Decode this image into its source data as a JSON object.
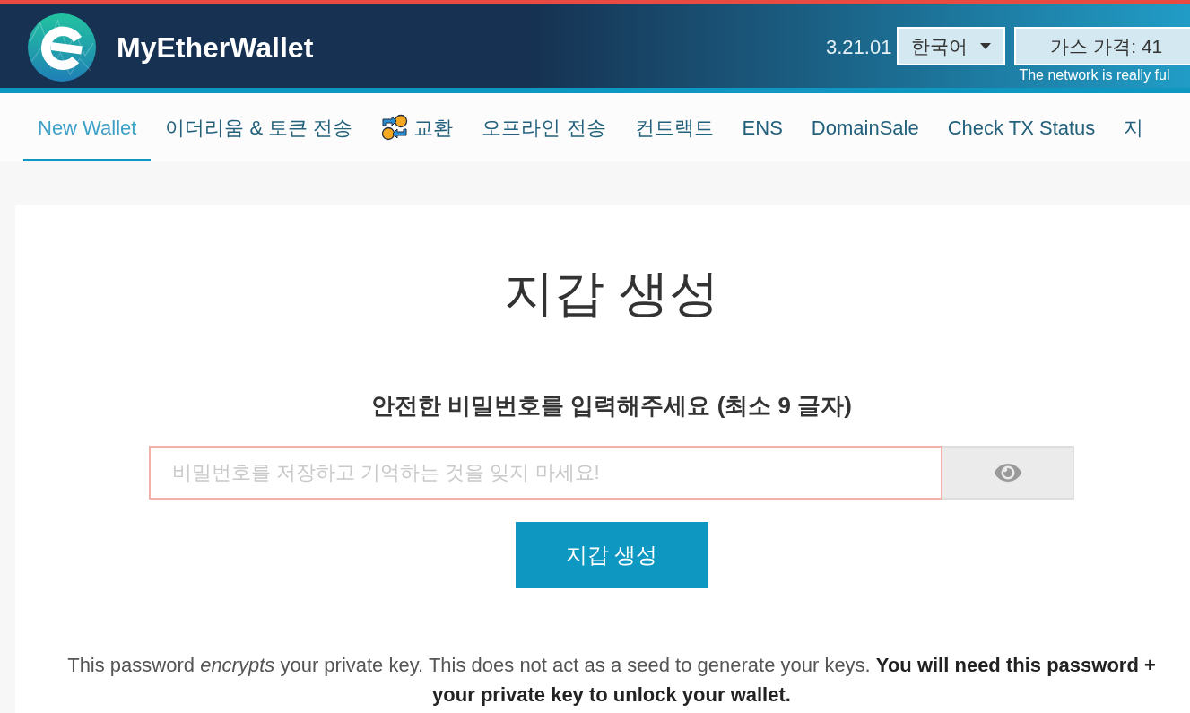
{
  "header": {
    "brand": "MyEtherWallet",
    "version": "3.21.01",
    "language_dropdown": {
      "value": "한국어"
    },
    "gas_price": {
      "label": "가스 가격: 41"
    },
    "network_notice": "The network is really ful"
  },
  "nav": {
    "items": [
      {
        "label": "New Wallet",
        "selected": true,
        "kind": "plain"
      },
      {
        "label": "이더리움 & 토큰 전송",
        "selected": false,
        "kind": "plain"
      },
      {
        "label": "교환",
        "selected": false,
        "kind": "with_icon"
      },
      {
        "label": "오프라인 전송",
        "selected": false,
        "kind": "plain"
      },
      {
        "label": "컨트랙트",
        "selected": false,
        "kind": "plain"
      },
      {
        "label": "ENS",
        "selected": false,
        "kind": "plain"
      },
      {
        "label": "DomainSale",
        "selected": false,
        "kind": "plain"
      },
      {
        "label": "Check TX Status",
        "selected": false,
        "kind": "plain"
      },
      {
        "label": "지",
        "selected": false,
        "kind": "plain"
      }
    ]
  },
  "create_wallet": {
    "title": "지갑 생성",
    "prompt": "안전한 비밀번호를 입력해주세요 (최소 9 글자)",
    "password_field": {
      "placeholder": "비밀번호를 저장하고 기억하는 것을 잊지 마세요!",
      "invalid": true
    },
    "submit_button": "지갑 생성",
    "note": "This password *encrypts* your private key. This does not act as a seed to generate your keys. **You will need this password + your private key to unlock your wallet.**"
  }
}
